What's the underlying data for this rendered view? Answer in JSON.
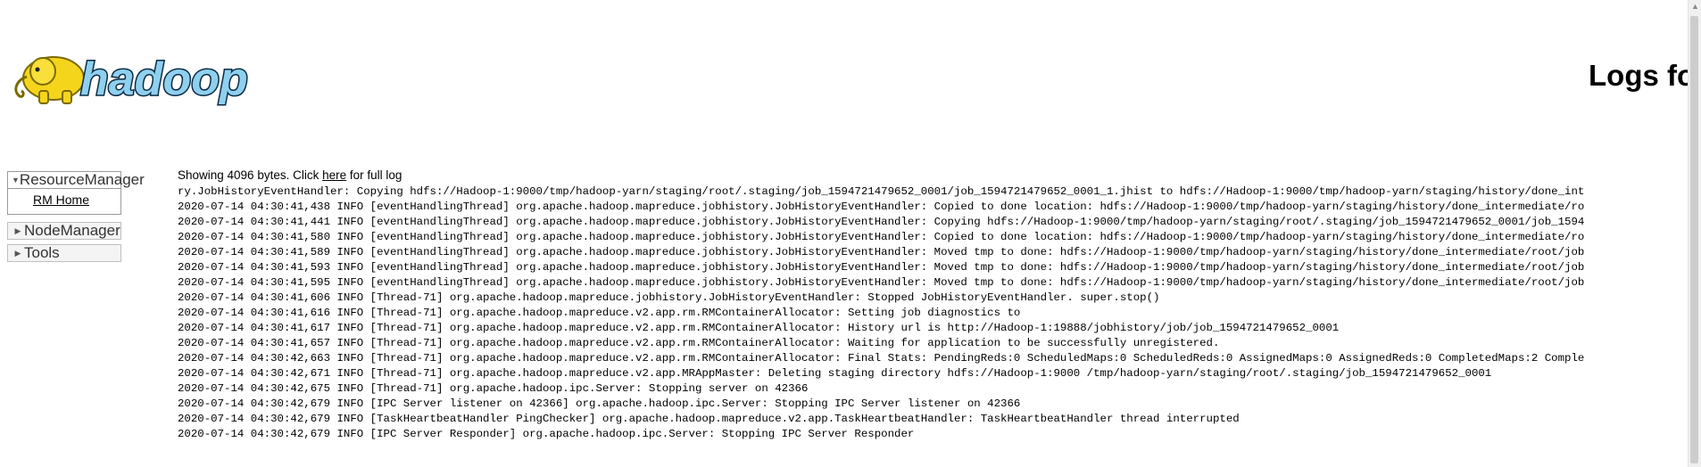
{
  "logo": {
    "text": "hadoop"
  },
  "header": {
    "title": "Logs fo"
  },
  "nav": {
    "sections": [
      {
        "label": "ResourceManager",
        "expanded": true,
        "items": [
          {
            "label": "RM Home"
          }
        ]
      },
      {
        "label": "NodeManager",
        "expanded": false
      },
      {
        "label": "Tools",
        "expanded": false
      }
    ]
  },
  "log": {
    "summary_prefix": "Showing 4096 bytes. Click ",
    "summary_link": "here",
    "summary_suffix": " for full log",
    "lines": [
      "ry.JobHistoryEventHandler: Copying hdfs://Hadoop-1:9000/tmp/hadoop-yarn/staging/root/.staging/job_1594721479652_0001/job_1594721479652_0001_1.jhist to hdfs://Hadoop-1:9000/tmp/hadoop-yarn/staging/history/done_int",
      "2020-07-14 04:30:41,438 INFO [eventHandlingThread] org.apache.hadoop.mapreduce.jobhistory.JobHistoryEventHandler: Copied to done location: hdfs://Hadoop-1:9000/tmp/hadoop-yarn/staging/history/done_intermediate/ro",
      "2020-07-14 04:30:41,441 INFO [eventHandlingThread] org.apache.hadoop.mapreduce.jobhistory.JobHistoryEventHandler: Copying hdfs://Hadoop-1:9000/tmp/hadoop-yarn/staging/root/.staging/job_1594721479652_0001/job_1594",
      "2020-07-14 04:30:41,580 INFO [eventHandlingThread] org.apache.hadoop.mapreduce.jobhistory.JobHistoryEventHandler: Copied to done location: hdfs://Hadoop-1:9000/tmp/hadoop-yarn/staging/history/done_intermediate/ro",
      "2020-07-14 04:30:41,589 INFO [eventHandlingThread] org.apache.hadoop.mapreduce.jobhistory.JobHistoryEventHandler: Moved tmp to done: hdfs://Hadoop-1:9000/tmp/hadoop-yarn/staging/history/done_intermediate/root/job",
      "2020-07-14 04:30:41,593 INFO [eventHandlingThread] org.apache.hadoop.mapreduce.jobhistory.JobHistoryEventHandler: Moved tmp to done: hdfs://Hadoop-1:9000/tmp/hadoop-yarn/staging/history/done_intermediate/root/job",
      "2020-07-14 04:30:41,595 INFO [eventHandlingThread] org.apache.hadoop.mapreduce.jobhistory.JobHistoryEventHandler: Moved tmp to done: hdfs://Hadoop-1:9000/tmp/hadoop-yarn/staging/history/done_intermediate/root/job",
      "2020-07-14 04:30:41,606 INFO [Thread-71] org.apache.hadoop.mapreduce.jobhistory.JobHistoryEventHandler: Stopped JobHistoryEventHandler. super.stop()",
      "2020-07-14 04:30:41,616 INFO [Thread-71] org.apache.hadoop.mapreduce.v2.app.rm.RMContainerAllocator: Setting job diagnostics to",
      "2020-07-14 04:30:41,617 INFO [Thread-71] org.apache.hadoop.mapreduce.v2.app.rm.RMContainerAllocator: History url is http://Hadoop-1:19888/jobhistory/job/job_1594721479652_0001",
      "2020-07-14 04:30:41,657 INFO [Thread-71] org.apache.hadoop.mapreduce.v2.app.rm.RMContainerAllocator: Waiting for application to be successfully unregistered.",
      "2020-07-14 04:30:42,663 INFO [Thread-71] org.apache.hadoop.mapreduce.v2.app.rm.RMContainerAllocator: Final Stats: PendingReds:0 ScheduledMaps:0 ScheduledReds:0 AssignedMaps:0 AssignedReds:0 CompletedMaps:2 Comple",
      "2020-07-14 04:30:42,671 INFO [Thread-71] org.apache.hadoop.mapreduce.v2.app.MRAppMaster: Deleting staging directory hdfs://Hadoop-1:9000 /tmp/hadoop-yarn/staging/root/.staging/job_1594721479652_0001",
      "2020-07-14 04:30:42,675 INFO [Thread-71] org.apache.hadoop.ipc.Server: Stopping server on 42366",
      "2020-07-14 04:30:42,679 INFO [IPC Server listener on 42366] org.apache.hadoop.ipc.Server: Stopping IPC Server listener on 42366",
      "2020-07-14 04:30:42,679 INFO [TaskHeartbeatHandler PingChecker] org.apache.hadoop.mapreduce.v2.app.TaskHeartbeatHandler: TaskHeartbeatHandler thread interrupted",
      "2020-07-14 04:30:42,679 INFO [IPC Server Responder] org.apache.hadoop.ipc.Server: Stopping IPC Server Responder"
    ]
  }
}
